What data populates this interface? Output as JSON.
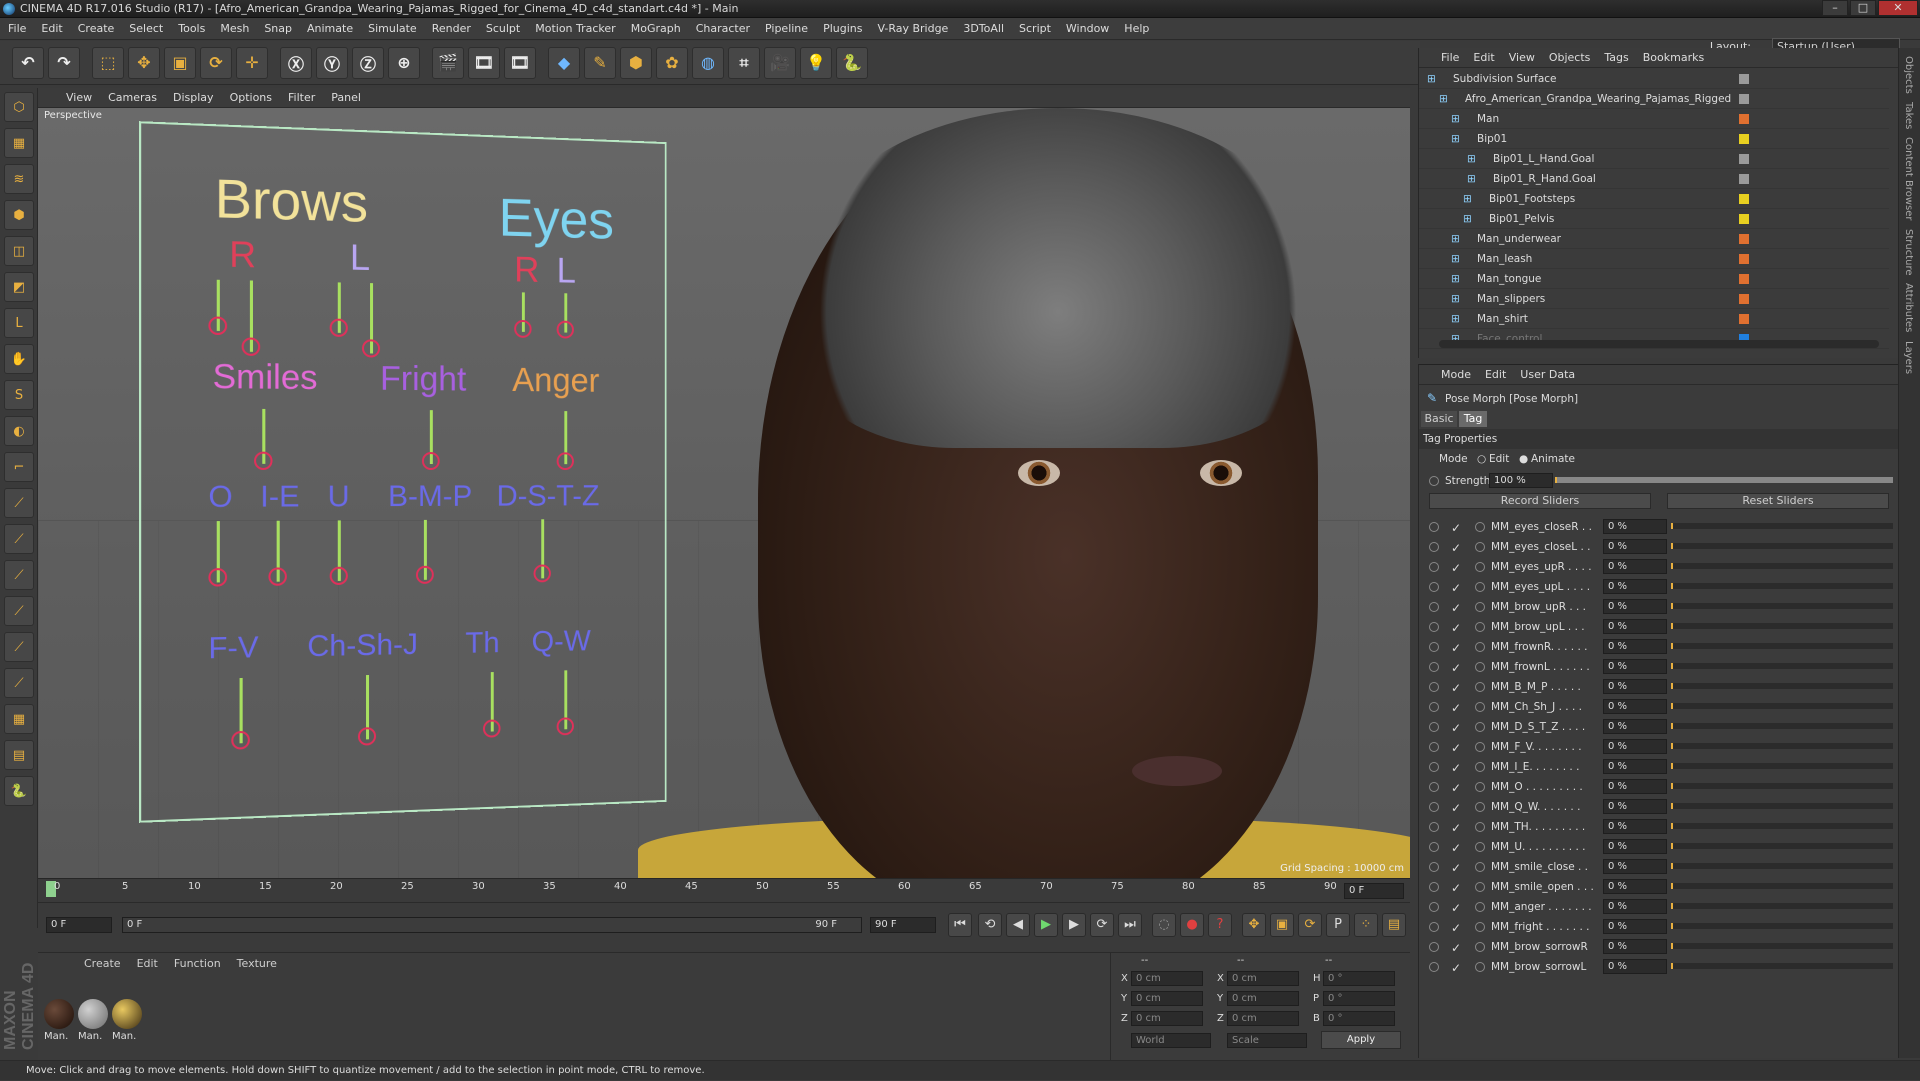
{
  "window": {
    "title": "CINEMA 4D R17.016 Studio (R17) - [Afro_American_Grandpa_Wearing_Pajamas_Rigged_for_Cinema_4D_c4d_standart.c4d *] - Main",
    "minimize": "–",
    "maximize": "□",
    "close": "✕"
  },
  "menu": [
    "File",
    "Edit",
    "Create",
    "Select",
    "Tools",
    "Mesh",
    "Snap",
    "Animate",
    "Simulate",
    "Render",
    "Sculpt",
    "Motion Tracker",
    "MoGraph",
    "Character",
    "Pipeline",
    "Plugins",
    "V-Ray Bridge",
    "3DToAll",
    "Script",
    "Window",
    "Help"
  ],
  "layout": {
    "label": "Layout:",
    "value": "Startup (User)"
  },
  "toolbar": {
    "icons": [
      "↶",
      "↷",
      "⬚",
      "✥",
      "▣",
      "⟳",
      "✛",
      "Ⓧ",
      "Ⓨ",
      "Ⓩ",
      "⊕",
      "🎬",
      "🎞",
      "🎞",
      "◆",
      "✎",
      "⬢",
      "✿",
      "◍",
      "⌗",
      "🎥",
      "💡",
      "🐍"
    ]
  },
  "lefttools": [
    "⬡",
    "▦",
    "≋",
    "⬢",
    "◫",
    "◩",
    "L",
    "✋",
    "S",
    "◐",
    "⌐",
    "⟋",
    "⟋",
    "⟋",
    "⟋",
    "⟋",
    "⟋",
    "▦",
    "▤",
    "🐍"
  ],
  "viewport": {
    "menu": [
      "View",
      "Cameras",
      "Display",
      "Options",
      "Filter",
      "Panel"
    ],
    "label": "Perspective",
    "grid_spacing": "Grid Spacing : 10000 cm",
    "board": {
      "brows": "Brows",
      "eyes": "Eyes",
      "brow_r": "R",
      "brow_l": "L",
      "eye_r": "R",
      "eye_l": "L",
      "smiles": "Smiles",
      "fright": "Fright",
      "anger": "Anger",
      "o": "O",
      "ie": "I-E",
      "u": "U",
      "bmp": "B-M-P",
      "dstz": "D-S-T-Z",
      "fv": "F-V",
      "chshj": "Ch-Sh-J",
      "th": "Th",
      "qw": "Q-W"
    },
    "colors": {
      "brows": "#f2e29a",
      "eyes": "#7fd4f0",
      "r": "#e0405a",
      "l": "#b9a6f2",
      "smiles": "#e36bd6",
      "fright": "#a860e0",
      "anger": "#e8a050",
      "phon": "#6a6ae8"
    }
  },
  "timeline": {
    "ticks": [
      "0",
      "5",
      "10",
      "15",
      "20",
      "25",
      "30",
      "35",
      "40",
      "45",
      "50",
      "55",
      "60",
      "65",
      "70",
      "75",
      "80",
      "85",
      "90"
    ],
    "end_frame": "0 F"
  },
  "timebar": {
    "start": "0 F",
    "range_start": "0 F",
    "range_end": "90 F",
    "end": "90 F",
    "controls": [
      "⏮",
      "⟲",
      "◀",
      "▶",
      "▶",
      "⟳",
      "⏭"
    ]
  },
  "materials": {
    "menu": [
      "Create",
      "Edit",
      "Function",
      "Texture"
    ],
    "items": [
      "Man.",
      "Man.",
      "Man."
    ]
  },
  "coords": {
    "header": [
      "--",
      "--",
      "--"
    ],
    "x": "0 cm",
    "y": "0 cm",
    "z": "0 cm",
    "sx": "0 cm",
    "sy": "0 cm",
    "sz": "0 cm",
    "h": "0 °",
    "p": "0 °",
    "b": "0 °",
    "labels": {
      "x": "X",
      "y": "Y",
      "z": "Z",
      "sx": "X",
      "sy": "Y",
      "sz": "Z",
      "h": "H",
      "p": "P",
      "b": "B"
    },
    "world": "World",
    "scale": "Scale",
    "apply": "Apply"
  },
  "status": "Move: Click and drag to move elements. Hold down SHIFT to quantize movement / add to the selection in point mode, CTRL to remove.",
  "objects": {
    "menu": [
      "File",
      "Edit",
      "View",
      "Objects",
      "Tags",
      "Bookmarks"
    ],
    "rows": [
      {
        "name": "Subdivision Surface",
        "color": "#9a9a9a"
      },
      {
        "name": "Afro_American_Grandpa_Wearing_Pajamas_Rigged",
        "color": "#9a9a9a"
      },
      {
        "name": "Man",
        "color": "#e07030"
      },
      {
        "name": "Bip01",
        "color": "#e8d020"
      },
      {
        "name": "Bip01_L_Hand.Goal",
        "color": "#9a9a9a"
      },
      {
        "name": "Bip01_R_Hand.Goal",
        "color": "#9a9a9a"
      },
      {
        "name": "Bip01_Footsteps",
        "color": "#e8d020"
      },
      {
        "name": "Bip01_Pelvis",
        "color": "#e8d020"
      },
      {
        "name": "Man_underwear",
        "color": "#e07030"
      },
      {
        "name": "Man_leash",
        "color": "#e07030"
      },
      {
        "name": "Man_tongue",
        "color": "#e07030"
      },
      {
        "name": "Man_slippers",
        "color": "#e07030"
      },
      {
        "name": "Man_shirt",
        "color": "#e07030"
      },
      {
        "name": "Face_control",
        "color": "#2080e0"
      }
    ]
  },
  "attributes": {
    "menu": [
      "Mode",
      "Edit",
      "User Data"
    ],
    "title": "Pose Morph [Pose Morph]",
    "tabs": [
      "Basic",
      "Tag"
    ],
    "section": "Tag Properties",
    "mode_label": "Mode",
    "mode_edit": "Edit",
    "mode_animate": "Animate",
    "strength_label": "Strength",
    "strength_value": "100 %",
    "record": "Record Sliders",
    "reset": "Reset Sliders",
    "morphs": [
      {
        "name": "MM_eyes_closeR . .",
        "value": "0 %"
      },
      {
        "name": "MM_eyes_closeL . .",
        "value": "0 %"
      },
      {
        "name": "MM_eyes_upR . . . .",
        "value": "0 %"
      },
      {
        "name": "MM_eyes_upL . . . .",
        "value": "0 %"
      },
      {
        "name": "MM_brow_upR . . .",
        "value": "0 %"
      },
      {
        "name": "MM_brow_upL . . .",
        "value": "0 %"
      },
      {
        "name": "MM_frownR. . . . . .",
        "value": "0 %"
      },
      {
        "name": "MM_frownL . . . . . .",
        "value": "0 %"
      },
      {
        "name": "MM_B_M_P . . . . .",
        "value": "0 %"
      },
      {
        "name": "MM_Ch_Sh_J . . . .",
        "value": "0 %"
      },
      {
        "name": "MM_D_S_T_Z . . . .",
        "value": "0 %"
      },
      {
        "name": "MM_F_V. . . . . . . .",
        "value": "0 %"
      },
      {
        "name": "MM_I_E. . . . . . . .",
        "value": "0 %"
      },
      {
        "name": "MM_O . . . . . . . . .",
        "value": "0 %"
      },
      {
        "name": "MM_Q_W. . . . . . .",
        "value": "0 %"
      },
      {
        "name": "MM_TH. . . . . . . . .",
        "value": "0 %"
      },
      {
        "name": "MM_U. . . . . . . . . .",
        "value": "0 %"
      },
      {
        "name": "MM_smile_close . .",
        "value": "0 %"
      },
      {
        "name": "MM_smile_open . . .",
        "value": "0 %"
      },
      {
        "name": "MM_anger . . . . . . .",
        "value": "0 %"
      },
      {
        "name": "MM_fright . . . . . . .",
        "value": "0 %"
      },
      {
        "name": "MM_brow_sorrowR",
        "value": "0 %"
      },
      {
        "name": "MM_brow_sorrowL",
        "value": "0 %"
      }
    ]
  },
  "rightstrip": [
    "Objects",
    "Takes",
    "Content Browser",
    "Structure",
    "Attributes",
    "Layers"
  ],
  "logo": "MAXON CINEMA 4D"
}
